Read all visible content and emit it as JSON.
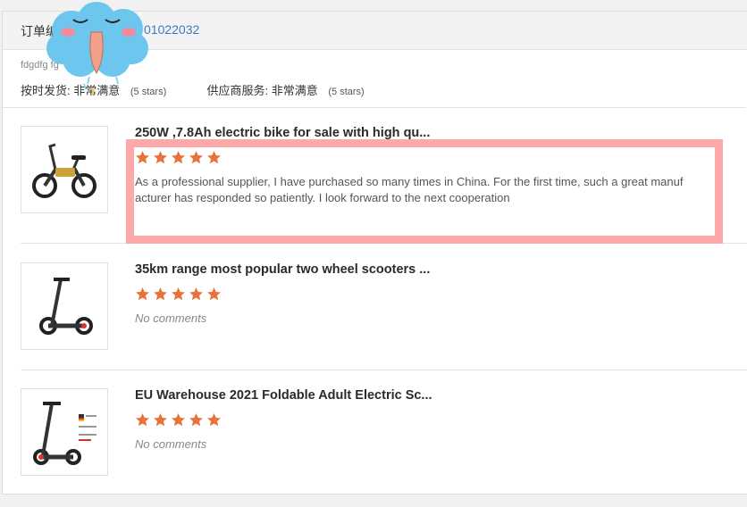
{
  "order": {
    "label": "订单编",
    "number": "01022032",
    "buyer_note": "fdgdfg fg",
    "ratings": [
      {
        "label": "按时发货:",
        "value": "非常满意",
        "stars_note": "(5 stars)"
      },
      {
        "label": "供应商服务:",
        "value": "非常满意",
        "stars_note": "(5 stars)"
      }
    ]
  },
  "items": [
    {
      "title": "250W ,7.8Ah electric bike for sale with high qu...",
      "rating": 5,
      "comment": "As a professional supplier, I have purchased so many times in China. For the first time, such a great manuf acturer has responded so patiently. I look forward to the next cooperation",
      "comment_empty": false,
      "thumb_icon": "electric-bike-icon"
    },
    {
      "title": "35km range most popular two wheel scooters ...",
      "rating": 5,
      "comment": "No comments",
      "comment_empty": true,
      "thumb_icon": "scooter-icon"
    },
    {
      "title": "EU Warehouse 2021 Foldable Adult Electric Sc...",
      "rating": 5,
      "comment": "No comments",
      "comment_empty": true,
      "thumb_icon": "foldable-scooter-icon"
    }
  ],
  "colors": {
    "star": "#e8723a",
    "highlight": "#fda9a9",
    "order_number": "#3d7bbf",
    "mascot": "#6cc6ee"
  }
}
